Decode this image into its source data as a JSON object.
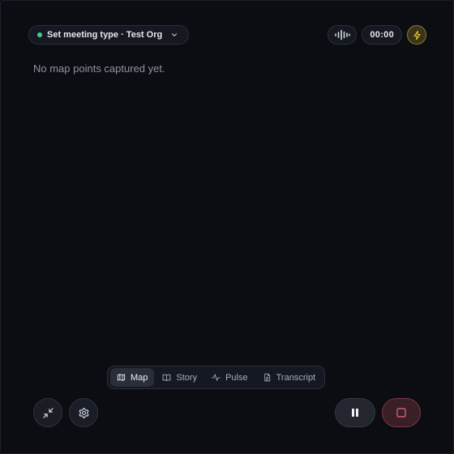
{
  "header": {
    "meeting_type_label": "Set meeting type · Test Org",
    "timer": "00:00"
  },
  "main": {
    "empty_message": "No map points captured yet."
  },
  "tabs": [
    {
      "label": "Map",
      "icon": "map-icon",
      "active": true
    },
    {
      "label": "Story",
      "icon": "book-icon",
      "active": false
    },
    {
      "label": "Pulse",
      "icon": "pulse-icon",
      "active": false
    },
    {
      "label": "Transcript",
      "icon": "document-icon",
      "active": false
    }
  ],
  "controls": {
    "left": [
      "minimize-icon",
      "gear-icon"
    ],
    "right": [
      "pause-icon",
      "stop-icon"
    ]
  },
  "colors": {
    "background": "#0b0d13",
    "status_green": "#3ecf8e",
    "bolt_yellow": "#e8c32e",
    "stop_red": "#e0707e"
  }
}
